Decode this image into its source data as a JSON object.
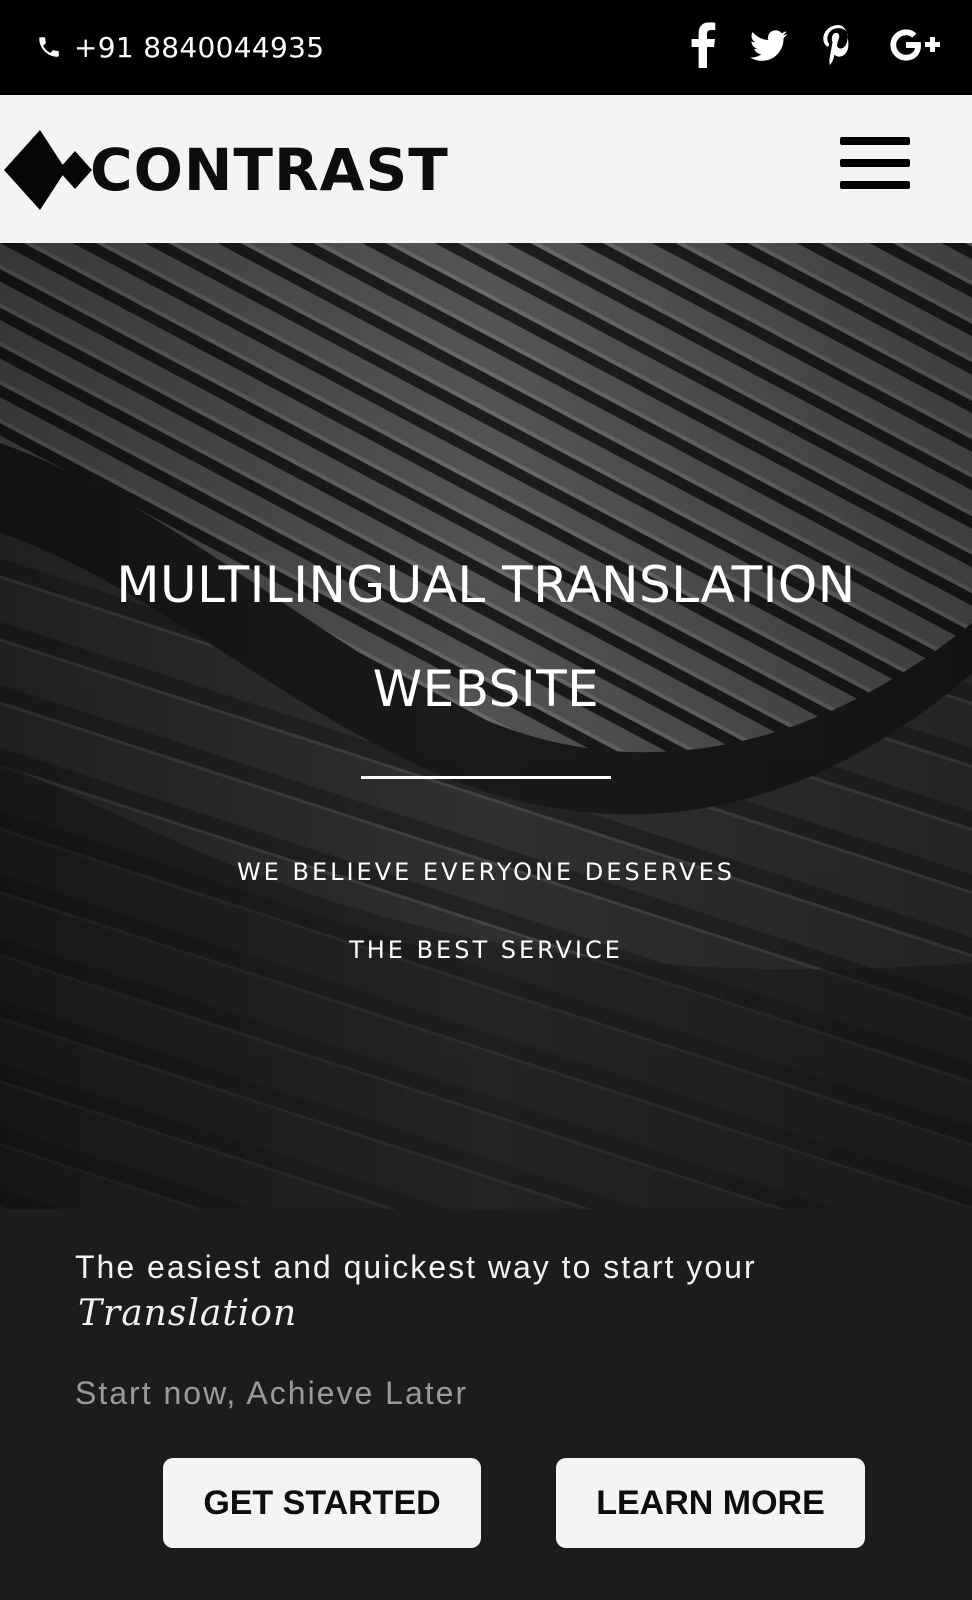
{
  "topbar": {
    "phone": "+91 8840044935",
    "phone_icon": "phone-icon",
    "social": [
      {
        "name": "facebook-icon"
      },
      {
        "name": "twitter-icon"
      },
      {
        "name": "pinterest-icon"
      },
      {
        "name": "google-plus-icon"
      }
    ]
  },
  "header": {
    "logo_text": "CONTRAST",
    "menu_icon": "hamburger-menu-icon"
  },
  "hero": {
    "title_line1": "MULTILINGUAL TRANSLATION",
    "title_line2": "WEBSITE",
    "subtitle_line1": "WE BELIEVE EVERYONE DESERVES",
    "subtitle_line2": "THE BEST SERVICE"
  },
  "cta": {
    "line1": "The easiest and quickest way to start your",
    "script_word": "Translation",
    "line2": "Start now, Achieve Later",
    "primary_button": "GET STARTED",
    "secondary_button": "LEARN MORE"
  },
  "colors": {
    "topbar_bg": "#000000",
    "header_bg": "#f4f4f4",
    "cta_bg": "#1c1c1c",
    "button_bg": "#f4f4f4",
    "muted_text": "#9a9a9a"
  }
}
